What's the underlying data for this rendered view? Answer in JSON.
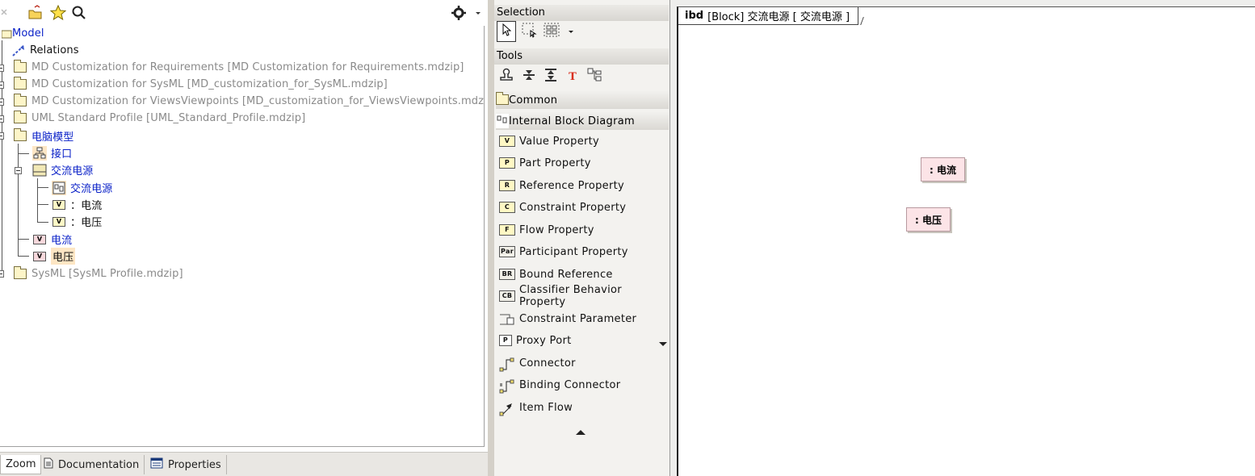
{
  "tree": {
    "toolbar_icons": [
      "folder-open-icon",
      "star-icon",
      "search-icon",
      "gear-icon",
      "chevron-down-icon"
    ],
    "nodes": [
      {
        "label": "Model",
        "style": "blue"
      },
      {
        "label": "Relations",
        "style": "black"
      },
      {
        "label": "MD Customization for Requirements [MD Customization for Requirements.mdzip]",
        "style": "gray"
      },
      {
        "label": "MD Customization for SysML [MD_customization_for_SysML.mdzip]",
        "style": "gray"
      },
      {
        "label": "MD Customization for ViewsViewpoints [MD_customization_for_ViewsViewpoints.mdzip]",
        "style": "gray"
      },
      {
        "label": "UML Standard Profile [UML_Standard_Profile.mdzip]",
        "style": "gray"
      },
      {
        "label": "电脑模型",
        "style": "blue"
      },
      {
        "label": "接口",
        "style": "blue"
      },
      {
        "label": "交流电源",
        "style": "blue"
      },
      {
        "label": "交流电源",
        "style": "blue"
      },
      {
        "label": "：电流",
        "style": "black"
      },
      {
        "label": "：电压",
        "style": "black"
      },
      {
        "label": "电流",
        "style": "blue"
      },
      {
        "label": "电压",
        "style": "black"
      },
      {
        "label": "SysML [SysML Profile.mdzip]",
        "style": "gray"
      }
    ]
  },
  "left_tabs": [
    "Zoom",
    "Documentation",
    "Properties"
  ],
  "palette": {
    "selection_header": "Selection",
    "tools_header": "Tools",
    "common_label": "Common",
    "ibd_label": "Internal Block Diagram",
    "items": [
      {
        "label": "Value Property",
        "icon_text": "V"
      },
      {
        "label": "Part Property",
        "icon_text": "P"
      },
      {
        "label": "Reference Property",
        "icon_text": "R"
      },
      {
        "label": "Constraint Property",
        "icon_text": "C"
      },
      {
        "label": "Flow Property",
        "icon_text": "F"
      },
      {
        "label": "Participant Property",
        "icon_text": "Par"
      },
      {
        "label": "Bound Reference",
        "icon_text": "BR"
      },
      {
        "label": "Classifier Behavior Property",
        "icon_text": "CB"
      },
      {
        "label": "Constraint Parameter",
        "icon_text": ""
      },
      {
        "label": "Proxy Port",
        "icon_text": "P"
      },
      {
        "label": "Connector",
        "icon_text": ""
      },
      {
        "label": "Binding Connector",
        "icon_text": ""
      },
      {
        "label": "Item Flow",
        "icon_text": ""
      }
    ]
  },
  "diagram": {
    "kind": "ibd",
    "title": "[Block] 交流电源 [ 交流电源 ]",
    "parts": [
      ": 电流",
      ": 电压"
    ]
  },
  "colors": {
    "tree_link": "#0b22c8",
    "tree_gray": "#8a8a8a",
    "part_fill": "#fce4e7",
    "highlight": "#fde6c4"
  }
}
